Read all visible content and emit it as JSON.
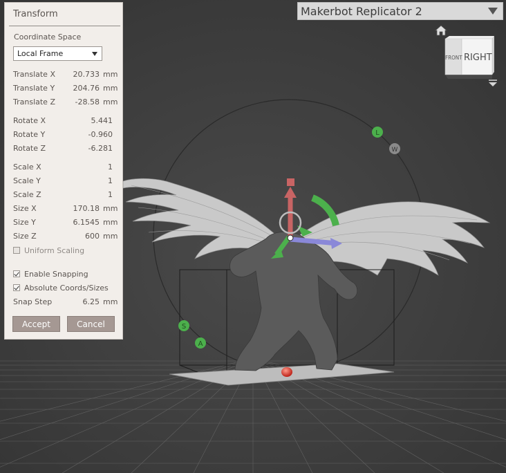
{
  "printer": {
    "selected": "Makerbot Replicator 2"
  },
  "view_cube": {
    "front_label": "FRONT",
    "right_label": "RIGHT"
  },
  "gizmo_labels": {
    "l": "L",
    "w": "W",
    "s": "S",
    "a": "A"
  },
  "panel": {
    "title": "Transform",
    "coordinate_space_label": "Coordinate Space",
    "coordinate_space_value": "Local Frame",
    "translate": [
      {
        "label": "Translate X",
        "value": "20.733",
        "unit": "mm"
      },
      {
        "label": "Translate Y",
        "value": "204.76",
        "unit": "mm"
      },
      {
        "label": "Translate Z",
        "value": "-28.58",
        "unit": "mm"
      }
    ],
    "rotate": [
      {
        "label": "Rotate X",
        "value": "5.441"
      },
      {
        "label": "Rotate Y",
        "value": "-0.960"
      },
      {
        "label": "Rotate Z",
        "value": "-6.281"
      }
    ],
    "scale": [
      {
        "label": "Scale X",
        "value": "1"
      },
      {
        "label": "Scale Y",
        "value": "1"
      },
      {
        "label": "Scale Z",
        "value": "1"
      }
    ],
    "size": [
      {
        "label": "Size X",
        "value": "170.18",
        "unit": "mm"
      },
      {
        "label": "Size Y",
        "value": "6.1545",
        "unit": "mm"
      },
      {
        "label": "Size Z",
        "value": "600",
        "unit": "mm"
      }
    ],
    "uniform_scaling": {
      "label": "Uniform Scaling",
      "checked": false
    },
    "enable_snapping": {
      "label": "Enable Snapping",
      "checked": true
    },
    "absolute_coords": {
      "label": "Absolute Coords/Sizes",
      "checked": true
    },
    "snap_step": {
      "label": "Snap Step",
      "value": "6.25",
      "unit": "mm"
    },
    "accept_label": "Accept",
    "cancel_label": "Cancel"
  }
}
